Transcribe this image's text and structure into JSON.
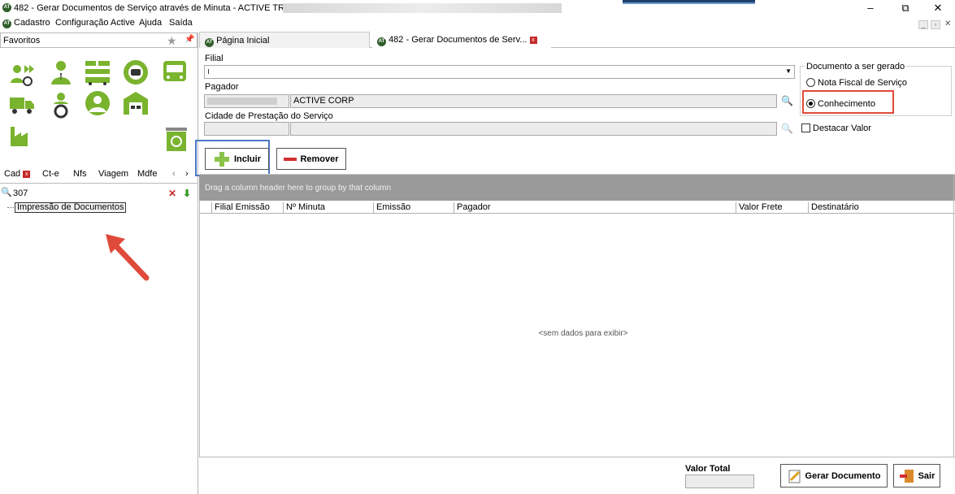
{
  "window": {
    "title": "482 - Gerar Documentos de Serviço através de Minuta - ACTIVE TRANS -",
    "controls": {
      "minimize": "–",
      "maximize": "⧉",
      "close": "✕"
    }
  },
  "menu": [
    "Cadastro",
    "Configuração Active",
    "Ajuda",
    "Saída"
  ],
  "favorites": {
    "label": "Favoritos"
  },
  "left_tabs": [
    {
      "label": "Cad"
    },
    {
      "label": "Ct-e"
    },
    {
      "label": "Nfs"
    },
    {
      "label": "Viagem"
    },
    {
      "label": "Mdfe"
    }
  ],
  "search": {
    "value": "307"
  },
  "tree": {
    "item": "Impressão de Documentos"
  },
  "doc_tabs": [
    {
      "label": "Página Inicial"
    },
    {
      "label": "482 - Gerar Documentos de Serv..."
    }
  ],
  "form": {
    "filial_label": "Filial",
    "filial_value": "",
    "pagador_label": "Pagador",
    "pagador_name": "ACTIVE CORP",
    "cidade_label": "Cidade de Prestação do Serviço",
    "documento_label": "Documento a ser gerado",
    "opt_nfs": "Nota Fiscal de Serviço",
    "opt_conhecimento": "Conhecimento",
    "destacar_label": "Destacar Valor"
  },
  "toolbar": {
    "incluir": "Incluir",
    "remover": "Remover"
  },
  "grid": {
    "group_hint": "Drag a column header here to group by that column",
    "columns": [
      "Filial Emissão",
      "Nº Minuta",
      "Emissão",
      "Pagador",
      "Valor Frete",
      "Destinatário"
    ],
    "empty": "<sem dados para exibir>"
  },
  "footer": {
    "valor_total_label": "Valor Total",
    "gerar_button": "Gerar Documento",
    "sair_button": "Sair"
  },
  "colors": {
    "accent_green": "#7ab32e",
    "annotation_red": "#e04a3a",
    "highlight_blue": "#4a78c8"
  }
}
